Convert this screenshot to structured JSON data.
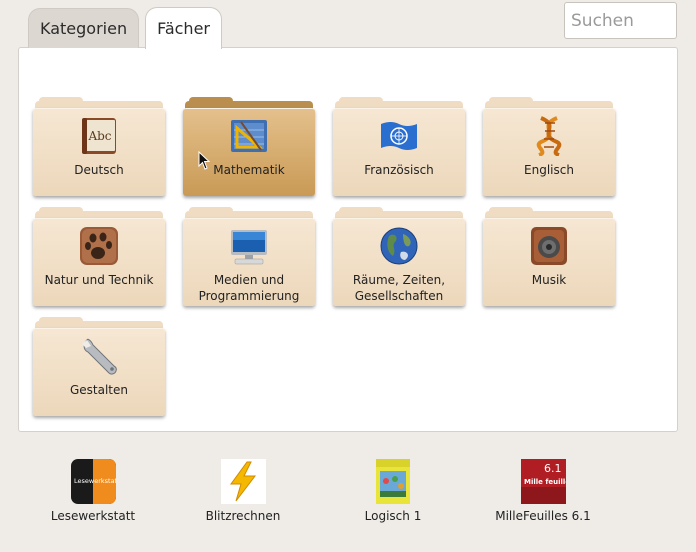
{
  "tabs": [
    {
      "label": "Kategorien"
    },
    {
      "label": "Fächer"
    }
  ],
  "search": {
    "placeholder": "Suchen",
    "value": ""
  },
  "folders": [
    {
      "label": "Deutsch",
      "icon": "book-icon"
    },
    {
      "label": "Mathematik",
      "icon": "math-tools-icon"
    },
    {
      "label": "Französisch",
      "icon": "un-flag-icon"
    },
    {
      "label": "Englisch",
      "icon": "dna-icon"
    },
    {
      "label": "Natur und Technik",
      "icon": "paw-icon"
    },
    {
      "label_line1": "Medien und",
      "label_line2": "Programmierung",
      "icon": "computer-icon"
    },
    {
      "label_line1": "Räume, Zeiten,",
      "label_line2": "Gesellschaften",
      "icon": "globe-icon"
    },
    {
      "label": "Musik",
      "icon": "speaker-icon"
    },
    {
      "label": "Gestalten",
      "icon": "wrench-icon"
    }
  ],
  "apps": [
    {
      "label": "Lesewerkstatt",
      "icon": "lesewerkstatt-icon",
      "icon_text": "Lesewerkstatt"
    },
    {
      "label": "Blitzrechnen",
      "icon": "lightning-icon"
    },
    {
      "label": "Logisch 1",
      "icon": "logisch-book-icon"
    },
    {
      "label": "MilleFeuilles 6.1",
      "icon": "millefeuilles-book-icon",
      "icon_text_top": "6.1",
      "icon_text_title": "Mille feuilles"
    }
  ],
  "colors": {
    "folder": "#ecd7ba",
    "folder_selected": "#c99a55",
    "background": "#efece8"
  }
}
